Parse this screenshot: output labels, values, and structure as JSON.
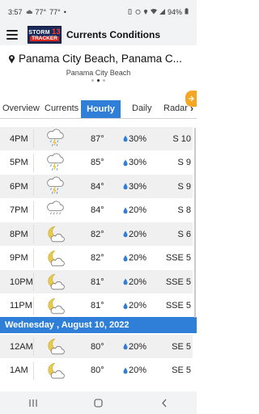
{
  "status_bar": {
    "time": "3:57",
    "temp_a": "77°",
    "temp_b": "77°",
    "dot": "•",
    "battery": "94%"
  },
  "app_bar": {
    "title": "Currents Conditions",
    "logo_line1": "STORM",
    "logo_number": "13",
    "logo_line2": "TRACKER"
  },
  "location": {
    "name": "Panama City Beach, Panama C...",
    "subtitle": "Panama City Beach",
    "pages": 3,
    "active_page": 1
  },
  "tabs": {
    "overview": "Overview",
    "currents": "Currents",
    "hourly": "Hourly",
    "daily": "Daily",
    "radar": "Radar",
    "active": "Hourly"
  },
  "hourly": [
    {
      "time": "4PM",
      "icon": "cloud-thunder-rain-icon",
      "temp": "87°",
      "pop": "30%",
      "wind": "S 10"
    },
    {
      "time": "5PM",
      "icon": "cloud-thunder-rain-icon",
      "temp": "85°",
      "pop": "30%",
      "wind": "S 9"
    },
    {
      "time": "6PM",
      "icon": "cloud-thunder-rain-icon",
      "temp": "84°",
      "pop": "30%",
      "wind": "S 9"
    },
    {
      "time": "7PM",
      "icon": "cloud-showers-icon",
      "temp": "84°",
      "pop": "20%",
      "wind": "S 8"
    },
    {
      "time": "8PM",
      "icon": "moon-cloud-icon",
      "temp": "82°",
      "pop": "20%",
      "wind": "S 6"
    },
    {
      "time": "9PM",
      "icon": "moon-cloud-icon",
      "temp": "82°",
      "pop": "20%",
      "wind": "SSE 5"
    },
    {
      "time": "10PM",
      "icon": "moon-cloud-icon",
      "temp": "81°",
      "pop": "20%",
      "wind": "SSE 5"
    },
    {
      "time": "11PM",
      "icon": "moon-cloud-icon",
      "temp": "81°",
      "pop": "20%",
      "wind": "SSE 5"
    }
  ],
  "date_header": "Wednesday , August 10, 2022",
  "hourly_next": [
    {
      "time": "12AM",
      "icon": "moon-cloud-icon",
      "temp": "80°",
      "pop": "20%",
      "wind": "SE 5"
    },
    {
      "time": "1AM",
      "icon": "moon-cloud-icon",
      "temp": "80°",
      "pop": "20%",
      "wind": "SE 5"
    }
  ],
  "colors": {
    "accent": "#2f7fd8",
    "row_alt": "#f0f0f0",
    "moon": "#e8c94a",
    "drop": "#2f7fd8",
    "side_tab": "#f5a623"
  }
}
